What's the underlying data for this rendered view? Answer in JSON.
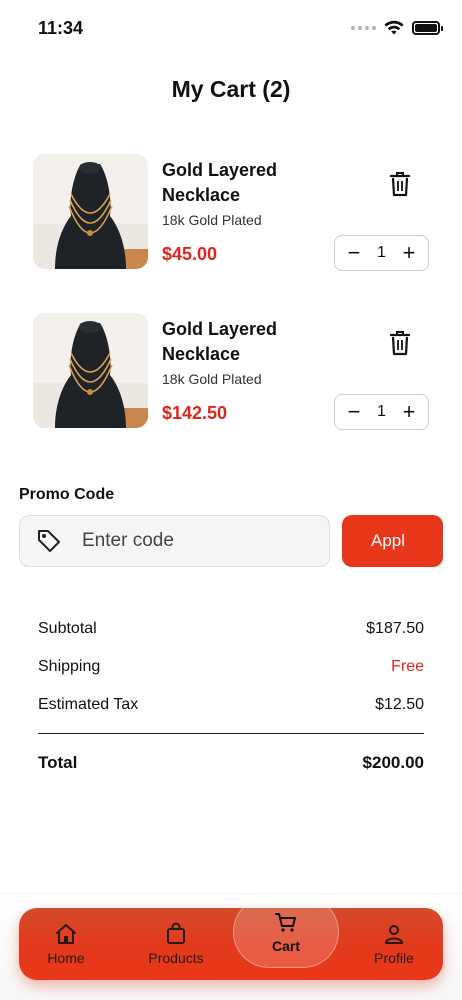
{
  "status_bar": {
    "time": "11:34"
  },
  "page": {
    "title": "My Cart (2)"
  },
  "cart_items": [
    {
      "name": "Gold Layered Necklace",
      "variant": "18k Gold Plated",
      "price": "$45.00",
      "quantity": "1"
    },
    {
      "name": "Gold Layered Necklace",
      "variant": "18k Gold Plated",
      "price": "$142.50",
      "quantity": "1"
    }
  ],
  "stepper": {
    "minus": "−",
    "plus": "+"
  },
  "promo": {
    "label": "Promo Code",
    "placeholder": "Enter code",
    "value": "",
    "apply_label": "Appl"
  },
  "summary": {
    "subtotal_label": "Subtotal",
    "subtotal_value": "$187.50",
    "shipping_label": "Shipping",
    "shipping_value": "Free",
    "tax_label": "Estimated Tax",
    "tax_value": "$12.50",
    "total_label": "Total",
    "total_value": "$200.00"
  },
  "nav": {
    "items": [
      {
        "label": "Home",
        "icon": "home-icon"
      },
      {
        "label": "Products",
        "icon": "bag-icon"
      },
      {
        "label": "Cart",
        "icon": "cart-icon",
        "active": true
      },
      {
        "label": "Profile",
        "icon": "user-icon"
      }
    ]
  },
  "colors": {
    "accent": "#e8361a",
    "price": "#e0261b"
  }
}
